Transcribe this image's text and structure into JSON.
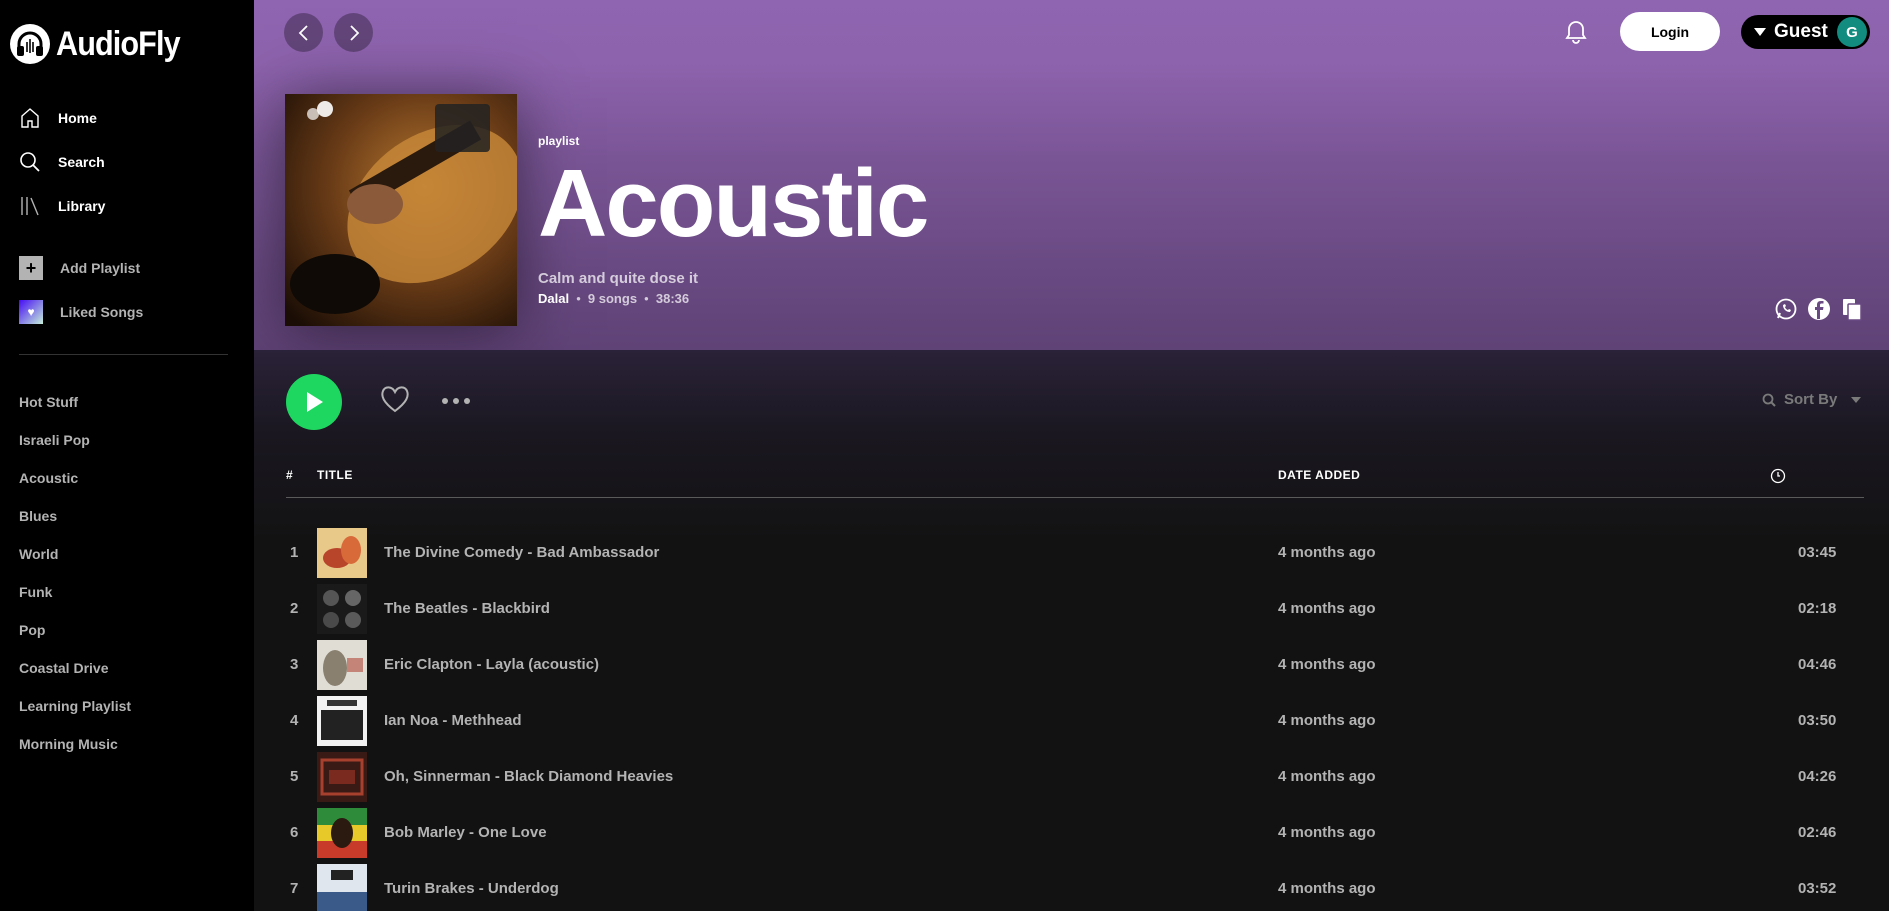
{
  "app": {
    "name": "AudioFly"
  },
  "sidebar": {
    "nav": [
      {
        "label": "Home",
        "icon": "home-icon"
      },
      {
        "label": "Search",
        "icon": "search-icon"
      },
      {
        "label": "Library",
        "icon": "library-icon"
      }
    ],
    "actions": [
      {
        "label": "Add Playlist",
        "icon": "plus-icon"
      },
      {
        "label": "Liked Songs",
        "icon": "heart-icon"
      }
    ],
    "playlists": [
      "Hot Stuff",
      "Israeli Pop",
      "Acoustic",
      "Blues",
      "World",
      "Funk",
      "Pop",
      "Coastal Drive",
      "Learning Playlist",
      "Morning Music"
    ]
  },
  "header": {
    "login_label": "Login",
    "user_label": "Guest",
    "avatar_initial": "G"
  },
  "playlist": {
    "type_label": "playlist",
    "title": "Acoustic",
    "description": "Calm and quite dose it",
    "owner": "Dalal",
    "song_count": "9 songs",
    "duration": "38:36",
    "share_icons": [
      "whatsapp-icon",
      "facebook-icon",
      "copy-icon"
    ]
  },
  "controls": {
    "sort_label": "Sort By"
  },
  "table": {
    "col_num": "#",
    "col_title": "TITLE",
    "col_date": "DATE ADDED",
    "col_duration_icon": "clock-icon"
  },
  "tracks": [
    {
      "num": "1",
      "title": "The Divine Comedy - Bad Ambassador",
      "date": "4 months ago",
      "duration": "03:45"
    },
    {
      "num": "2",
      "title": "The Beatles - Blackbird",
      "date": "4 months ago",
      "duration": "02:18"
    },
    {
      "num": "3",
      "title": "Eric Clapton - Layla (acoustic)",
      "date": "4 months ago",
      "duration": "04:46"
    },
    {
      "num": "4",
      "title": "Ian Noa - Methhead",
      "date": "4 months ago",
      "duration": "03:50"
    },
    {
      "num": "5",
      "title": "Oh, Sinnerman - Black Diamond Heavies",
      "date": "4 months ago",
      "duration": "04:26"
    },
    {
      "num": "6",
      "title": "Bob Marley - One Love",
      "date": "4 months ago",
      "duration": "02:46"
    },
    {
      "num": "7",
      "title": "Turin Brakes - Underdog",
      "date": "4 months ago",
      "duration": "03:52"
    }
  ],
  "colors": {
    "accent_green": "#1ed760",
    "hero_purple": "#8f64b1",
    "avatar_teal": "#128c7e"
  }
}
